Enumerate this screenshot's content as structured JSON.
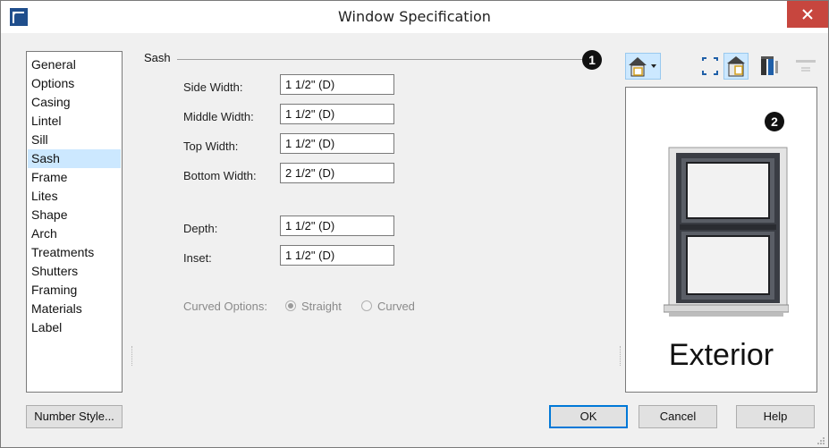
{
  "window": {
    "title": "Window Specification",
    "close_glyph": "×"
  },
  "sidebar": {
    "selected": "Sash",
    "items": [
      "General",
      "Options",
      "Casing",
      "Lintel",
      "Sill",
      "Sash",
      "Frame",
      "Lites",
      "Shape",
      "Arch",
      "Treatments",
      "Shutters",
      "Framing",
      "Materials",
      "Label"
    ]
  },
  "sash": {
    "group_title": "Sash",
    "side_width": {
      "label": "Side Width:",
      "value": "1 1/2\" (D)"
    },
    "middle_width": {
      "label": "Middle Width:",
      "value": "1 1/2\" (D)"
    },
    "top_width": {
      "label": "Top Width:",
      "value": "1 1/2\" (D)"
    },
    "bottom_width": {
      "label": "Bottom Width:",
      "value": "2 1/2\" (D)"
    },
    "depth": {
      "label": "Depth:",
      "value": "1 1/2\" (D)"
    },
    "inset": {
      "label": "Inset:",
      "value": "1 1/2\" (D)"
    },
    "curved_options": {
      "label": "Curved Options:",
      "options": [
        "Straight",
        "Curved"
      ],
      "selected": "Straight",
      "enabled": false
    }
  },
  "callouts": {
    "one": "1",
    "two": "2"
  },
  "preview_toolbar": {
    "icons": [
      "house-view-dropdown-icon",
      "fit-to-window-icon",
      "view-toggle-icon",
      "frame-view-icon",
      "swap-view-icon"
    ]
  },
  "preview": {
    "label": "Exterior"
  },
  "buttons": {
    "number_style": "Number Style...",
    "ok": "OK",
    "cancel": "Cancel",
    "help": "Help"
  },
  "colors": {
    "accent_selected": "#cce8ff",
    "toolbar_active": "#cce8ff",
    "close": "#c7463e",
    "window_frame": "#3c3f4a"
  }
}
